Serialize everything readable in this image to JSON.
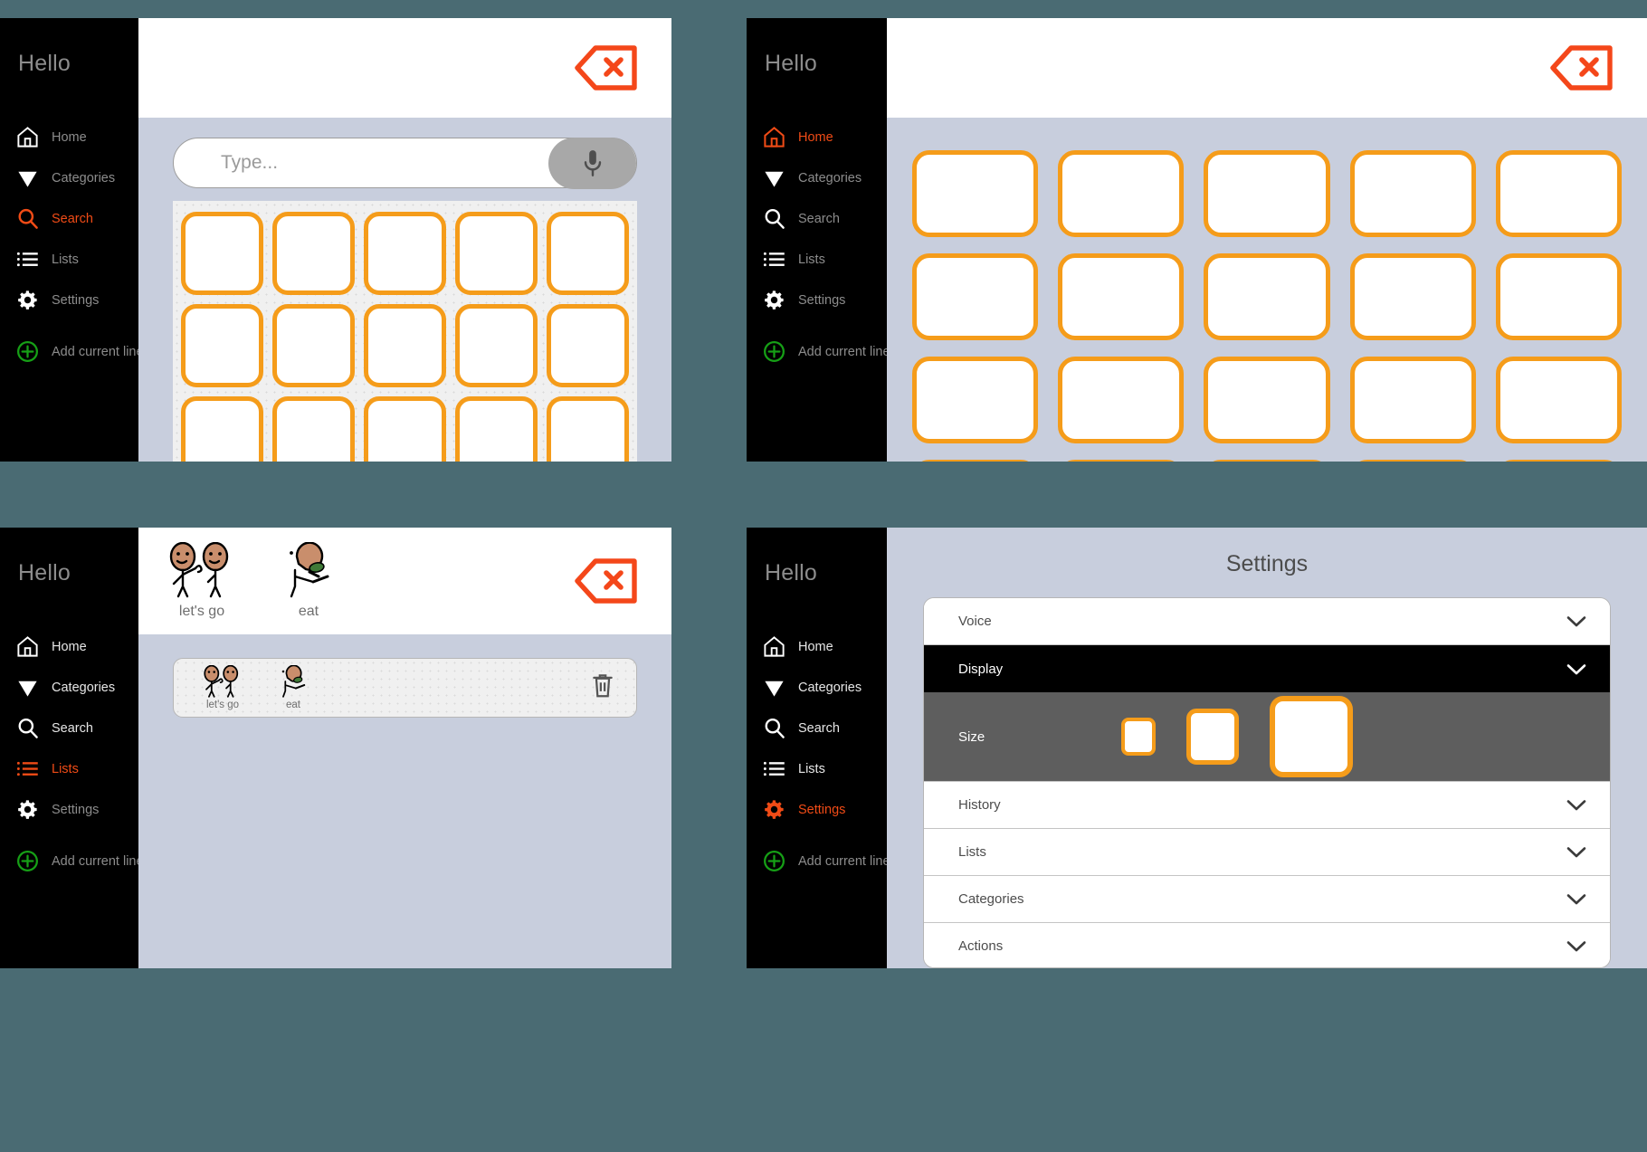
{
  "app": {
    "greeting": "Hello",
    "accent_orange": "#f59c1a",
    "accent_red": "#f04b16",
    "accent_green": "#16a016",
    "bg_teal": "#4a6b73",
    "bg_panel": "#c8cedd"
  },
  "nav_items": [
    {
      "label": "Home",
      "icon": "home-icon"
    },
    {
      "label": "Categories",
      "icon": "triangle-down-icon"
    },
    {
      "label": "Search",
      "icon": "search-icon"
    },
    {
      "label": "Lists",
      "icon": "list-icon"
    },
    {
      "label": "Settings",
      "icon": "gear-icon"
    },
    {
      "label": "Add current line",
      "icon": "plus-circle-icon"
    }
  ],
  "panels": {
    "search_screen": {
      "active_nav": "Search",
      "search": {
        "value": "",
        "placeholder": "Type...",
        "mic_icon": "microphone-icon"
      },
      "backspace_icon": "backspace-delete-icon",
      "grid": {
        "columns": 5,
        "rows": 3,
        "cells": 15
      }
    },
    "home_screen": {
      "active_nav": "Home",
      "backspace_icon": "backspace-delete-icon",
      "grid": {
        "columns": 5,
        "rows": 4,
        "cells": 20
      }
    },
    "lists_screen": {
      "active_nav": "Lists",
      "backspace_icon": "backspace-delete-icon",
      "sentence": [
        {
          "label": "let's go",
          "art": "two-people-waving-pictogram"
        },
        {
          "label": "eat",
          "art": "person-eating-pictogram"
        }
      ],
      "history_rows": [
        {
          "delete_icon": "trash-icon",
          "symbols": [
            {
              "label": "let's go",
              "art": "two-people-waving-pictogram"
            },
            {
              "label": "eat",
              "art": "person-eating-pictogram"
            }
          ]
        }
      ]
    },
    "settings_screen": {
      "active_nav": "Settings",
      "title": "Settings",
      "rows": [
        {
          "label": "Voice",
          "open": false,
          "chevron": "chevron-down-icon"
        },
        {
          "label": "Display",
          "open": true,
          "chevron": "chevron-down-icon"
        },
        {
          "label": "History",
          "open": false,
          "chevron": "chevron-down-icon"
        },
        {
          "label": "Lists",
          "open": false,
          "chevron": "chevron-down-icon"
        },
        {
          "label": "Categories",
          "open": false,
          "chevron": "chevron-down-icon"
        },
        {
          "label": "Actions",
          "open": false,
          "chevron": "chevron-down-icon"
        }
      ],
      "display_panel": {
        "size_label": "Size",
        "options": [
          "small",
          "medium",
          "large"
        ]
      }
    }
  }
}
